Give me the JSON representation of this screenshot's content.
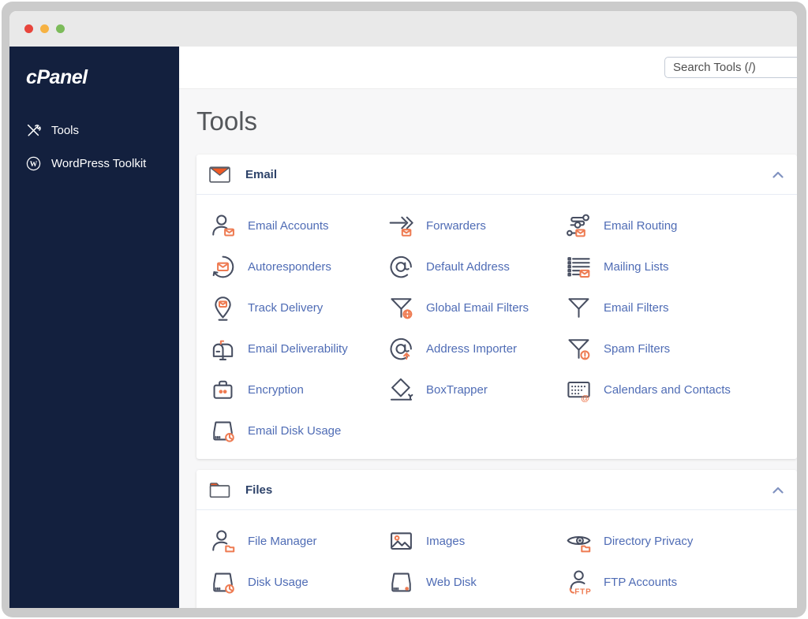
{
  "window": {
    "traffic_lights": [
      {
        "name": "close",
        "color": "#E8453C"
      },
      {
        "name": "minimize",
        "color": "#F6B243"
      },
      {
        "name": "maximize",
        "color": "#7CBB5A"
      }
    ]
  },
  "sidebar": {
    "logo_text": "cPanel",
    "items": [
      {
        "label": "Tools",
        "icon": "tools-icon"
      },
      {
        "label": "WordPress Toolkit",
        "icon": "wordpress-icon"
      }
    ]
  },
  "topbar": {
    "search_placeholder": "Search Tools (/)"
  },
  "main": {
    "title": "Tools"
  },
  "sections": [
    {
      "title": "Email",
      "icon": "email-section-icon",
      "collapse_icon": "chevron-up-icon",
      "items": [
        {
          "label": "Email Accounts",
          "icon": "email-accounts-icon"
        },
        {
          "label": "Forwarders",
          "icon": "forwarders-icon"
        },
        {
          "label": "Email Routing",
          "icon": "email-routing-icon"
        },
        {
          "label": "Autoresponders",
          "icon": "autoresponders-icon"
        },
        {
          "label": "Default Address",
          "icon": "default-address-icon"
        },
        {
          "label": "Mailing Lists",
          "icon": "mailing-lists-icon"
        },
        {
          "label": "Track Delivery",
          "icon": "track-delivery-icon"
        },
        {
          "label": "Global Email Filters",
          "icon": "global-email-filters-icon"
        },
        {
          "label": "Email Filters",
          "icon": "email-filters-icon"
        },
        {
          "label": "Email Deliverability",
          "icon": "email-deliverability-icon"
        },
        {
          "label": "Address Importer",
          "icon": "address-importer-icon"
        },
        {
          "label": "Spam Filters",
          "icon": "spam-filters-icon"
        },
        {
          "label": "Encryption",
          "icon": "encryption-icon"
        },
        {
          "label": "BoxTrapper",
          "icon": "boxtrapper-icon"
        },
        {
          "label": "Calendars and Contacts",
          "icon": "calendars-and-contacts-icon"
        },
        {
          "label": "Email Disk Usage",
          "icon": "email-disk-usage-icon"
        }
      ]
    },
    {
      "title": "Files",
      "icon": "files-section-icon",
      "collapse_icon": "chevron-up-icon",
      "items": [
        {
          "label": "File Manager",
          "icon": "file-manager-icon"
        },
        {
          "label": "Images",
          "icon": "images-icon"
        },
        {
          "label": "Directory Privacy",
          "icon": "directory-privacy-icon"
        },
        {
          "label": "Disk Usage",
          "icon": "disk-usage-icon"
        },
        {
          "label": "Web Disk",
          "icon": "web-disk-icon"
        },
        {
          "label": "FTP Accounts",
          "icon": "ftp-accounts-icon"
        }
      ]
    }
  ],
  "colors": {
    "sidebar_bg": "#13203E",
    "link_blue": "#4F6CB5",
    "icon_stroke": "#474E61",
    "accent_orange": "#EE7B52",
    "vivid_orange": "#F15A24",
    "section_title": "#2D4269",
    "chevron": "#8092C0"
  }
}
